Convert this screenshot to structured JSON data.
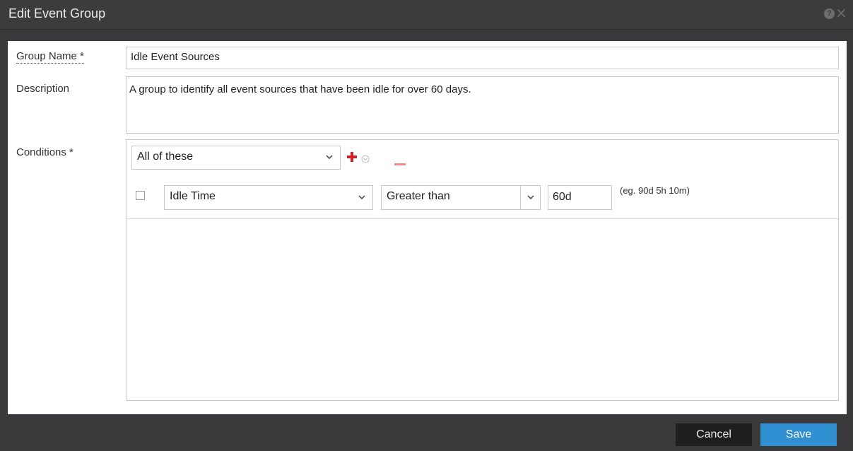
{
  "dialog": {
    "title": "Edit Event Group",
    "help_icon": "question-circle-icon",
    "close_icon": "close-icon"
  },
  "form": {
    "group_name_label": "Group Name *",
    "group_name_value": "Idle Event Sources",
    "description_label": "Description",
    "description_value": "A group to identify all event sources that have been idle for over 60 days.",
    "conditions_label": "Conditions *"
  },
  "conditions": {
    "match_select": "All of these",
    "add_icon": "plus-icon",
    "expand_icon": "circle-chevron-down-icon",
    "remove_icon": "minus-icon",
    "rule": {
      "checked": false,
      "field": "Idle Time",
      "operator": "Greater than",
      "value": "60d",
      "hint": "(eg. 90d 5h 10m)"
    }
  },
  "footer": {
    "cancel_label": "Cancel",
    "save_label": "Save"
  },
  "colors": {
    "title_bar": "#3c3c3e",
    "panel": "#ffffff",
    "save_button": "#2f8fd0",
    "cancel_button": "#1e1e20",
    "add_icon": "#d0202a",
    "remove_icon": "#f08c8c"
  }
}
